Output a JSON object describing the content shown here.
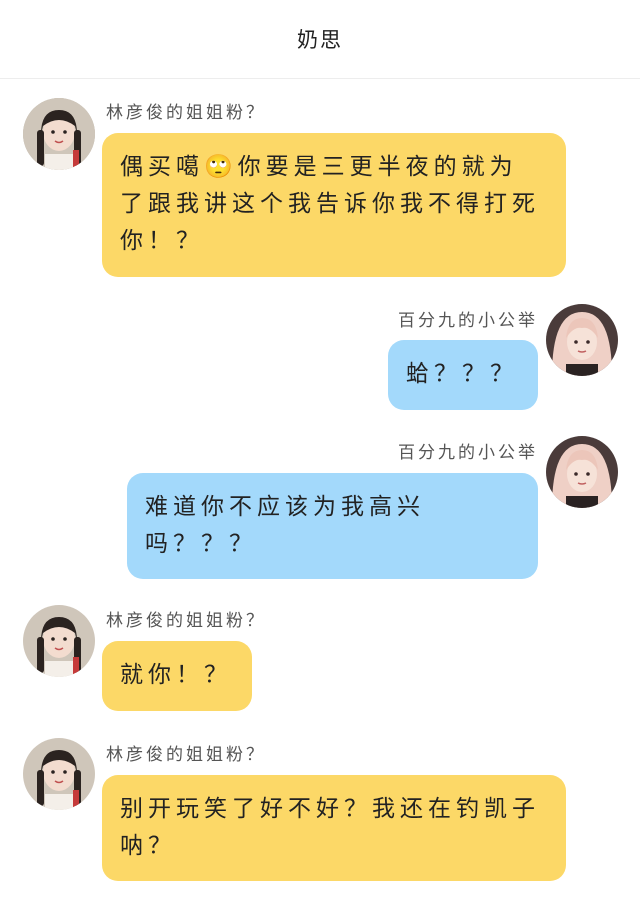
{
  "header": {
    "title": "奶思"
  },
  "colors": {
    "left_bubble": "#fcd867",
    "right_bubble": "#a3d9fb"
  },
  "messages": [
    {
      "side": "left",
      "sender": "林彦俊的姐姐粉？",
      "lines": [
        "偶买噶🙄你要是三更半夜的就为",
        "了跟我讲这个我告诉你我不得打死",
        "你！？"
      ]
    },
    {
      "side": "right",
      "sender": "百分九的小公举",
      "lines": [
        "蛤？？？"
      ]
    },
    {
      "side": "right",
      "sender": "百分九的小公举",
      "lines": [
        "难道你不应该为我高兴",
        "吗？？？"
      ]
    },
    {
      "side": "left",
      "sender": "林彦俊的姐姐粉？",
      "lines": [
        "就你！？"
      ]
    },
    {
      "side": "left",
      "sender": "林彦俊的姐姐粉？",
      "lines": [
        "别开玩笑了好不好？我还在钓凯子",
        "呐？"
      ]
    }
  ]
}
